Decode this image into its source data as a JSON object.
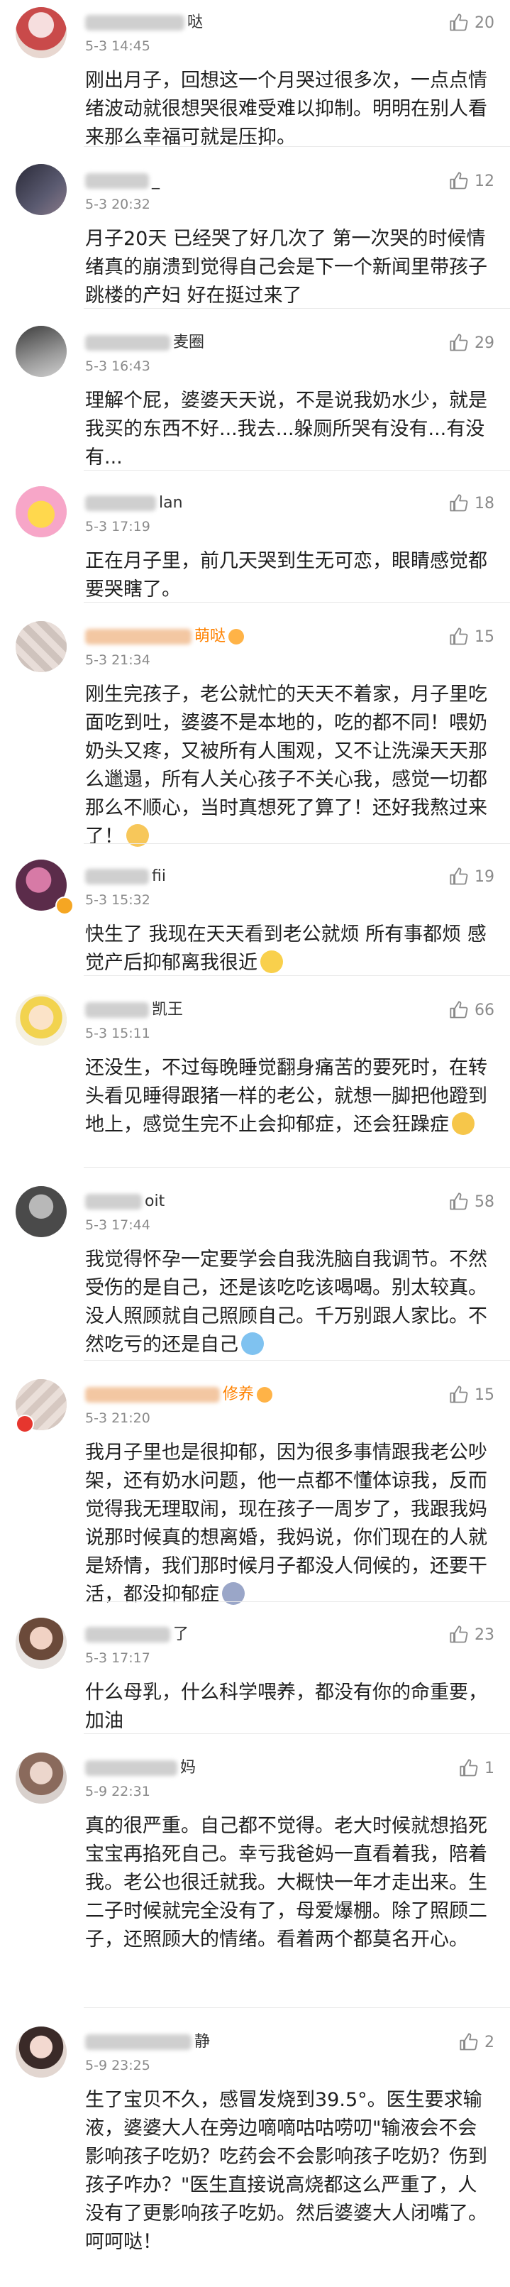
{
  "comments": [
    {
      "name_visible": "哒",
      "time": "5-3 14:45",
      "likes": "20",
      "text": "刚出月子，回想这一个月哭过很多次，一点点情绪波动就很想哭很难受难以抑制。明明在别人看来那么幸福可就是压抑。",
      "emoji": "",
      "orange": false
    },
    {
      "name_visible": "_",
      "time": "5-3 20:32",
      "likes": "12",
      "text": "月子20天 已经哭了好几次了 第一次哭的时候情绪真的崩溃到觉得自己会是下一个新闻里带孩子跳楼的产妇 好在挺过来了",
      "emoji": "",
      "orange": false
    },
    {
      "name_visible": "麦圈",
      "time": "5-3 16:43",
      "likes": "29",
      "text": "理解个屁，婆婆天天说，不是说我奶水少，就是我买的东西不好...我去...躲厕所哭有没有...有没有...",
      "emoji": "",
      "orange": false
    },
    {
      "name_visible": "lan",
      "time": "5-3 17:19",
      "likes": "18",
      "text": "正在月子里，前几天哭到生无可恋，眼睛感觉都要哭瞎了。",
      "emoji": "",
      "orange": false
    },
    {
      "name_visible": "萌哒",
      "time": "5-3 21:34",
      "likes": "15",
      "text": "刚生完孩子，老公就忙的天天不着家，月子里吃面吃到吐，婆婆不是本地的，吃的都不同！喂奶奶头又疼，又被所有人围观，又不让洗澡天天那么邋遢，所有人关心孩子不关心我，感觉一切都那么不顺心，当时真想死了算了！还好我熬过来了！",
      "emoji": "#f7c75a",
      "orange": true
    },
    {
      "name_visible": "fii",
      "time": "5-3 15:32",
      "likes": "19",
      "text": "快生了 我现在天天看到老公就烦 所有事都烦 感觉产后抑郁离我很近",
      "emoji": "#f9d04c",
      "orange": false
    },
    {
      "name_visible": "凯王",
      "time": "5-3 15:11",
      "likes": "66",
      "text": "还没生，不过每晚睡觉翻身痛苦的要死时，在转头看见睡得跟猪一样的老公，就想一脚把他蹬到地上，感觉生完不止会抑郁症，还会狂躁症",
      "emoji": "#f6c64a",
      "orange": false
    },
    {
      "name_visible": "oit",
      "time": "5-3 17:44",
      "likes": "58",
      "text": "我觉得怀孕一定要学会自我洗脑自我调节。不然受伤的是自己，还是该吃吃该喝喝。别太较真。没人照顾就自己照顾自己。千万别跟人家比。不然吃亏的还是自己",
      "emoji": "#7fc2f0",
      "orange": false
    },
    {
      "name_visible": "修养",
      "time": "5-3 21:20",
      "likes": "15",
      "text": "我月子里也是很抑郁，因为很多事情跟我老公吵架，还有奶水问题，他一点都不懂体谅我，反而觉得我无理取闹，现在孩子一周岁了，我跟我妈说那时候真的想离婚，我妈说，你们现在的人就是矫情，我们那时候月子都没人伺候的，还要干活，都没抑郁症",
      "emoji": "#9aa6c8",
      "orange": true
    },
    {
      "name_visible": "了",
      "time": "5-3 17:17",
      "likes": "23",
      "text": "什么母乳，什么科学喂养，都没有你的命重要，加油",
      "emoji": "",
      "orange": false
    },
    {
      "name_visible": "妈",
      "time": "5-9 22:31",
      "likes": "1",
      "text": "真的很严重。自己都不觉得。老大时候就想掐死宝宝再掐死自己。幸亏我爸妈一直看着我，陪着我。老公也很迁就我。大概快一年才走出来。生二子时候就完全没有了，母爱爆棚。除了照顾二子，还照顾大的情绪。看着两个都莫名开心。",
      "emoji": "",
      "orange": false
    },
    {
      "name_visible": "静",
      "time": "5-9 23:25",
      "likes": "2",
      "text": "生了宝贝不久，感冒发烧到39.5°。医生要求输液，婆婆大人在旁边嘀嘀咕咕唠叨\"输液会不会影响孩子吃奶？吃药会不会影响孩子吃奶？伤到孩子咋办？\"医生直接说高烧都这么严重了，人没有了更影响孩子吃奶。然后婆婆大人闭嘴了。呵呵哒！",
      "emoji": "",
      "orange": false
    }
  ],
  "colors": {
    "orange_name": "#ff8200",
    "time": "#8a8a8a",
    "text": "#1f1f1f",
    "divider": "#e9e9e9"
  }
}
